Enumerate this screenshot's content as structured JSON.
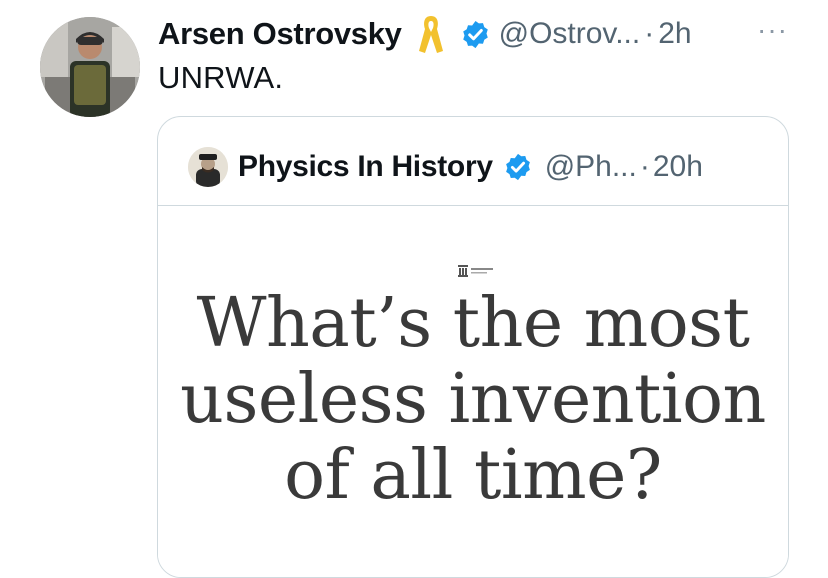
{
  "tweet": {
    "author_name": "Arsen Ostrovsky",
    "handle": "@Ostrov...",
    "separator": "·",
    "time": "2h",
    "more_label": "···",
    "text": "UNRWA.",
    "icons": [
      "yellow-ribbon-icon",
      "verified-badge-icon",
      "more-icon"
    ],
    "colors": {
      "verified": "#1d9bf0",
      "ribbon": "#f2c12e",
      "secondary_text": "#536471"
    }
  },
  "quoted_tweet": {
    "author_name": "Physics In History",
    "handle": "@Ph...",
    "separator": "·",
    "time": "20h",
    "headline_lines": [
      "What’s the most",
      "useless invention",
      "of all time?"
    ]
  }
}
